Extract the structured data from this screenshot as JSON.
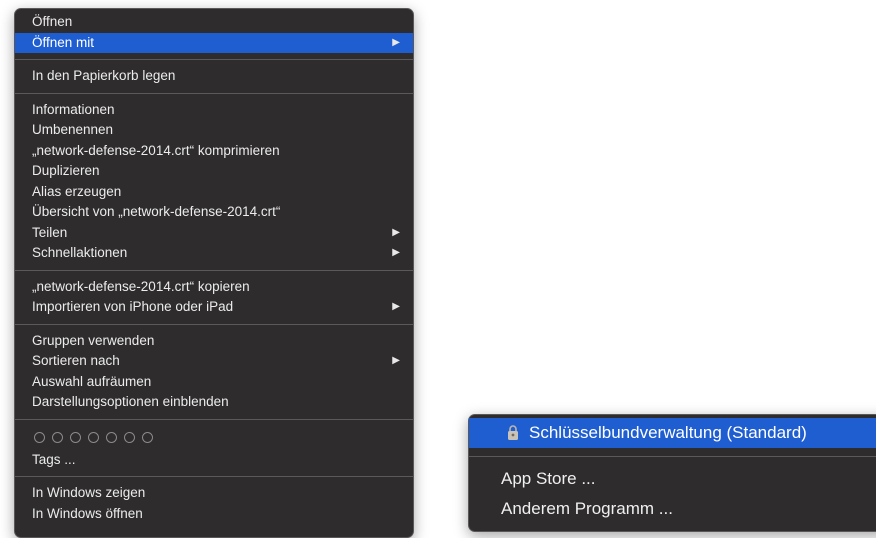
{
  "context_menu": {
    "groups": [
      [
        {
          "label": "Öffnen",
          "has_submenu": false,
          "selected": false
        },
        {
          "label": "Öffnen mit",
          "has_submenu": true,
          "selected": true
        }
      ],
      [
        {
          "label": "In den Papierkorb legen",
          "has_submenu": false
        }
      ],
      [
        {
          "label": "Informationen",
          "has_submenu": false
        },
        {
          "label": "Umbenennen",
          "has_submenu": false
        },
        {
          "label": "„network-defense-2014.crt“ komprimieren",
          "has_submenu": false
        },
        {
          "label": "Duplizieren",
          "has_submenu": false
        },
        {
          "label": "Alias erzeugen",
          "has_submenu": false
        },
        {
          "label": "Übersicht von „network-defense-2014.crt“",
          "has_submenu": false
        },
        {
          "label": "Teilen",
          "has_submenu": true
        },
        {
          "label": "Schnellaktionen",
          "has_submenu": true
        }
      ],
      [
        {
          "label": "„network-defense-2014.crt“ kopieren",
          "has_submenu": false
        },
        {
          "label": "Importieren von iPhone oder iPad",
          "has_submenu": true
        }
      ],
      [
        {
          "label": "Gruppen verwenden",
          "has_submenu": false
        },
        {
          "label": "Sortieren nach",
          "has_submenu": true
        },
        {
          "label": "Auswahl aufräumen",
          "has_submenu": false
        },
        {
          "label": "Darstellungsoptionen einblenden",
          "has_submenu": false
        }
      ]
    ],
    "tag_colors_count": 7,
    "tags_label": "Tags ...",
    "last_group": [
      {
        "label": "In Windows zeigen",
        "has_submenu": false
      },
      {
        "label": "In Windows öffnen",
        "has_submenu": false
      }
    ],
    "submenu_arrow": "▶"
  },
  "submenu": {
    "default_app": {
      "label": "Schlüsselbundverwaltung (Standard)",
      "icon": "keychain-icon",
      "selected": true
    },
    "items": [
      {
        "label": "App Store ..."
      },
      {
        "label": "Anderem Programm ..."
      }
    ]
  },
  "colors": {
    "menu_bg": "#2e2c2c",
    "highlight": "#1f5ed1",
    "separator": "#5b5959",
    "text": "#ececec"
  }
}
